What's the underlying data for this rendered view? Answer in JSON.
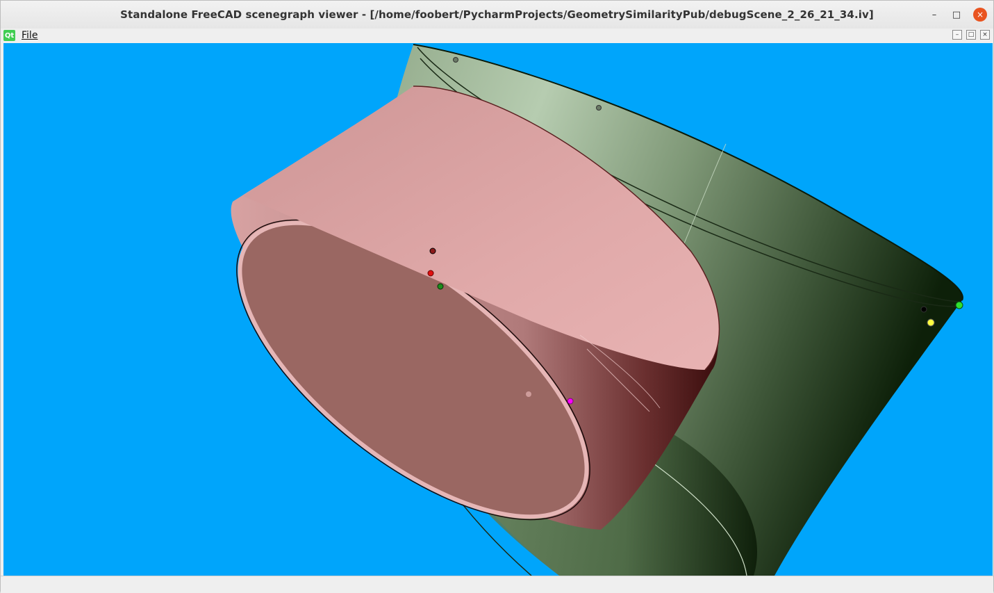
{
  "window": {
    "title": "Standalone FreeCAD scenegraph viewer - [/home/foobert/PycharmProjects/GeometrySimilarityPub/debugScene_2_26_21_34.iv]",
    "controls": {
      "minimize": "–",
      "maximize": "□",
      "close": "×"
    }
  },
  "menubar": {
    "logo": "Qt",
    "file_label": "File",
    "mdi_buttons": [
      "–",
      "□",
      "×"
    ]
  },
  "viewport": {
    "background": "#00a5fb",
    "pink_cylinder_color": "#d6a0a0",
    "green_cylinder_color": "#6f8a68",
    "markers": [
      {
        "name": "dark-red-marker",
        "color": "#8b1a1a"
      },
      {
        "name": "red-marker",
        "color": "#e01010"
      },
      {
        "name": "green-marker",
        "color": "#1c8c1c"
      },
      {
        "name": "magenta-marker",
        "color": "#ff00ff"
      },
      {
        "name": "black-marker",
        "color": "#000000"
      },
      {
        "name": "lime-marker",
        "color": "#30e030"
      },
      {
        "name": "yellow-marker",
        "color": "#ffff40"
      },
      {
        "name": "grey-marker-1",
        "color": "#555555"
      },
      {
        "name": "grey-marker-2",
        "color": "#555555"
      }
    ]
  }
}
